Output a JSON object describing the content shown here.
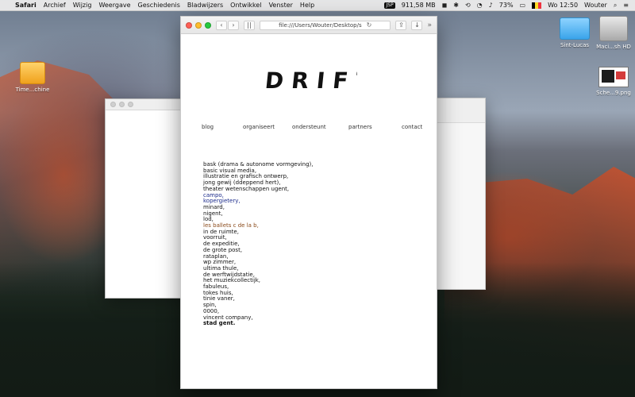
{
  "menubar": {
    "apple_icon": "",
    "app_name": "Safari",
    "menus": [
      "Archief",
      "Wijzig",
      "Weergave",
      "Geschiedenis",
      "Bladwijzers",
      "Ontwikkel",
      "Venster",
      "Help"
    ],
    "status": {
      "pill": "JSP",
      "memory": "911,58 MB",
      "battery": "73%",
      "clock": "Wo 12:50",
      "user": "Wouter"
    }
  },
  "desktop_icons": [
    {
      "label": "Time...chine",
      "icon": "drive-orange-icon"
    },
    {
      "label": "Sint-Lucas",
      "icon": "folder-icon"
    },
    {
      "label": "Maci...sh HD",
      "icon": "hard-drive-icon"
    },
    {
      "label": "Sche...9.png",
      "icon": "screenshot-file-icon"
    }
  ],
  "safari": {
    "address": "file:///Users/Wouter/Desktop/s",
    "buttons": {
      "back": "‹",
      "forward": "›",
      "sidebar": "||",
      "share": "⇪",
      "download": "↓",
      "more": "»",
      "reload": "↻"
    }
  },
  "site": {
    "logo_text": "DRIFT",
    "nav": [
      "blog",
      "organiseert",
      "ondersteunt",
      "partners",
      "contact"
    ],
    "list": [
      {
        "text": "bask (drama & autonome vormgeving),",
        "style": "normal"
      },
      {
        "text": "basic visual media,",
        "style": "normal"
      },
      {
        "text": "illustratie en grafisch ontwerp,",
        "style": "normal"
      },
      {
        "text": "jong gewij (ddeppend hert),",
        "style": "normal"
      },
      {
        "text": "theater wetenschappen ugent,",
        "style": "normal"
      },
      {
        "text": "campo,",
        "style": "blue"
      },
      {
        "text": "kopergietery,",
        "style": "blue"
      },
      {
        "text": "minard,",
        "style": "normal"
      },
      {
        "text": "nigent,",
        "style": "normal"
      },
      {
        "text": "lod,",
        "style": "normal"
      },
      {
        "text": "les ballets c de la b,",
        "style": "orange"
      },
      {
        "text": "in de ruimte,",
        "style": "normal"
      },
      {
        "text": "voorruit,",
        "style": "normal"
      },
      {
        "text": "de expeditie,",
        "style": "normal"
      },
      {
        "text": "de grote post,",
        "style": "normal"
      },
      {
        "text": "rataplan,",
        "style": "normal"
      },
      {
        "text": "wp zimmer,",
        "style": "normal"
      },
      {
        "text": "ultima thule,",
        "style": "normal"
      },
      {
        "text": "de werftwijdstatie,",
        "style": "normal"
      },
      {
        "text": "het muziekcollectijk,",
        "style": "normal"
      },
      {
        "text": "fabuleus,",
        "style": "normal"
      },
      {
        "text": "tokes huis,",
        "style": "normal"
      },
      {
        "text": "tinie vaner,",
        "style": "normal"
      },
      {
        "text": "spin,",
        "style": "normal"
      },
      {
        "text": "0000,",
        "style": "normal"
      },
      {
        "text": "vincent company,",
        "style": "normal"
      },
      {
        "text": "stad gent.",
        "style": "bold"
      }
    ]
  },
  "colors": {
    "traffic_red": "#ff5f56",
    "traffic_yellow": "#ffbd2e",
    "traffic_green": "#27c93f",
    "list_blue": "#1a2a8a",
    "list_orange": "#8a4a1a"
  }
}
